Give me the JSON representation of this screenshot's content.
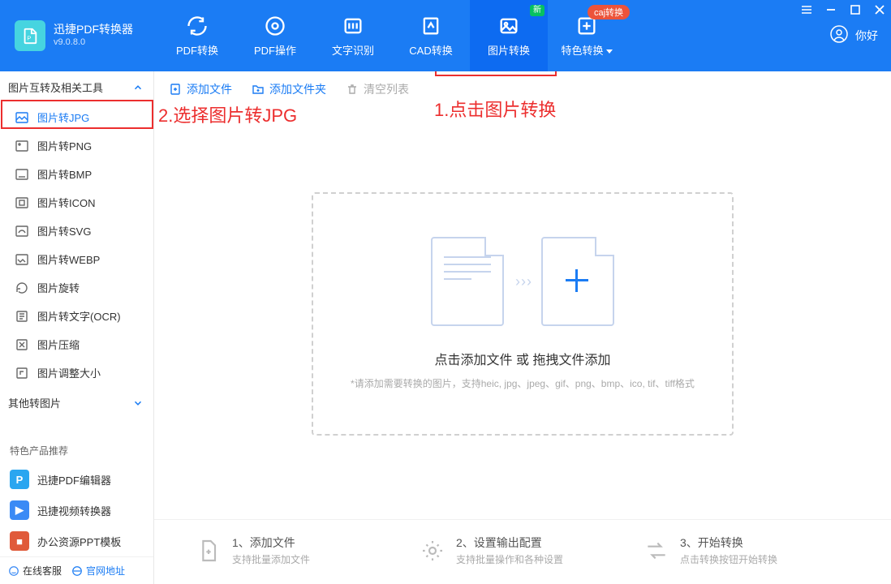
{
  "app": {
    "name": "迅捷PDF转换器",
    "version": "v9.0.8.0"
  },
  "tabs": [
    {
      "label": "PDF转换"
    },
    {
      "label": "PDF操作"
    },
    {
      "label": "文字识别"
    },
    {
      "label": "CAD转换"
    },
    {
      "label": "图片转换",
      "badge": "新",
      "active": true
    },
    {
      "label": "特色转换",
      "dropdown": true
    }
  ],
  "caj_badge": "caj转换",
  "user": {
    "nick": "你好"
  },
  "sidebar": {
    "group1": {
      "title": "图片互转及相关工具"
    },
    "items": [
      "图片转JPG",
      "图片转PNG",
      "图片转BMP",
      "图片转ICON",
      "图片转SVG",
      "图片转WEBP",
      "图片旋转",
      "图片转文字(OCR)",
      "图片压缩",
      "图片调整大小"
    ],
    "group2": {
      "title": "其他转图片"
    }
  },
  "promo": {
    "title": "特色产品推荐",
    "items": [
      "迅捷PDF编辑器",
      "迅捷视频转换器",
      "办公资源PPT模板"
    ]
  },
  "footer": {
    "lnk1": "在线客服",
    "lnk2": "官网地址"
  },
  "toolbar": {
    "add_file": "添加文件",
    "add_folder": "添加文件夹",
    "clear": "清空列表"
  },
  "dropzone": {
    "text": "点击添加文件 或 拖拽文件添加",
    "hint": "*请添加需要转换的图片，支持heic, jpg、jpeg、gif、png、bmp、ico, tif、tiff格式"
  },
  "steps": [
    {
      "t1": "1、添加文件",
      "t2": "支持批量添加文件"
    },
    {
      "t1": "2、设置输出配置",
      "t2": "支持批量操作和各种设置"
    },
    {
      "t1": "3、开始转换",
      "t2": "点击转换按钮开始转换"
    }
  ],
  "anno": {
    "a1": "1.点击图片转换",
    "a2": "2.选择图片转JPG"
  }
}
